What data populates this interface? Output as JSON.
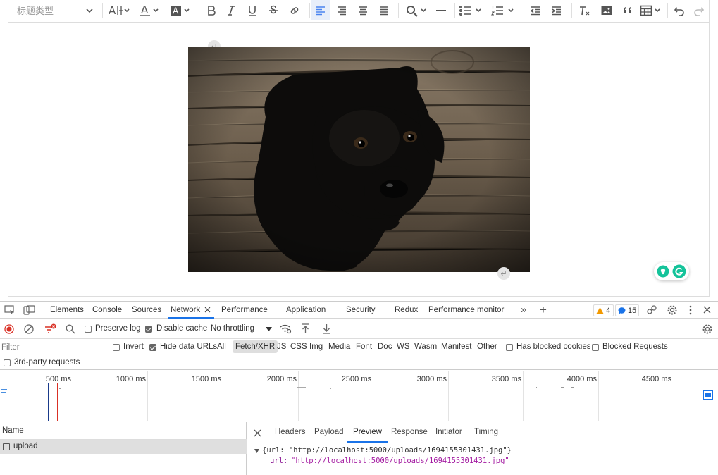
{
  "editor": {
    "heading_select": "标题类型",
    "toolbar_items": [
      "font-size",
      "font-color",
      "background-color",
      "bold",
      "italic",
      "underline",
      "strikethrough",
      "link",
      "align-left",
      "align-right",
      "align-center",
      "align-justify",
      "find-replace",
      "horizontal-rule",
      "bulleted-list",
      "numbered-list",
      "outdent",
      "indent",
      "clear-format",
      "image",
      "blockquote",
      "table",
      "undo",
      "redo"
    ],
    "return_marker": "↵",
    "image_alt": "black puppy on wooden floor"
  },
  "devtools": {
    "tabs": [
      "Elements",
      "Console",
      "Sources",
      "Network",
      "Performance",
      "Application",
      "Security",
      "Redux",
      "Performance monitor"
    ],
    "active_tab": "Network",
    "more_tabs": "»",
    "add_tab": "+",
    "warnings_count": "4",
    "messages_count": "15",
    "network": {
      "preserve_log": "Preserve log",
      "disable_cache": "Disable cache",
      "throttling": "No throttling",
      "filter_placeholder": "Filter",
      "invert": "Invert",
      "hide_data_urls": "Hide data URLs",
      "type_filters": [
        "All",
        "Fetch/XHR",
        "JS",
        "CSS",
        "Img",
        "Media",
        "Font",
        "Doc",
        "WS",
        "Wasm",
        "Manifest",
        "Other"
      ],
      "active_type": "Fetch/XHR",
      "has_blocked_cookies": "Has blocked cookies",
      "blocked_requests": "Blocked Requests",
      "third_party": "3rd-party requests",
      "timeline_ticks": [
        "500 ms",
        "1000 ms",
        "1500 ms",
        "2000 ms",
        "2500 ms",
        "3000 ms",
        "3500 ms",
        "4000 ms",
        "4500 ms"
      ],
      "name_header": "Name",
      "requests": [
        "upload"
      ],
      "detail_tabs": [
        "Headers",
        "Payload",
        "Preview",
        "Response",
        "Initiator",
        "Timing"
      ],
      "active_detail_tab": "Preview",
      "preview_summary": "{url: \"http://localhost:5000/uploads/1694155301431.jpg\"}",
      "preview_key": "url:",
      "preview_value": "\"http://localhost:5000/uploads/1694155301431.jpg\""
    }
  },
  "colors": {
    "accent": "#1a73e8",
    "active_align": "#4a83f0",
    "record": "#d93025",
    "grammarly": "#15c39a",
    "string_value": "#a31aa1"
  }
}
